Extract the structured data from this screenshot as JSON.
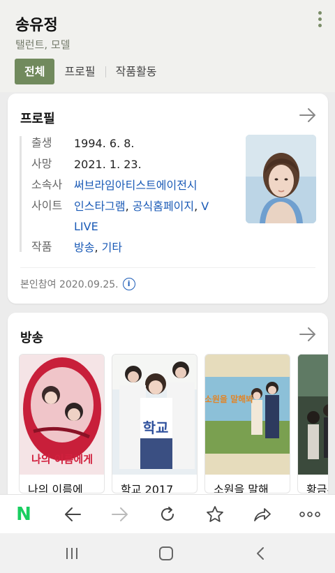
{
  "header": {
    "title": "송유정",
    "subtitle": "탤런트, 모델",
    "tabs": [
      "전체",
      "프로필",
      "작품활동"
    ]
  },
  "profile": {
    "title": "프로필",
    "rows": [
      {
        "label": "출생",
        "value": "1994. 6. 8."
      },
      {
        "label": "사망",
        "value": "2021. 1. 23."
      },
      {
        "label": "소속사",
        "value": "써브라임아티스트에이전시"
      },
      {
        "label": "사이트",
        "links": [
          "인스타그램",
          "공식홈페이지",
          "V LIVE"
        ]
      },
      {
        "label": "작품",
        "links": [
          "방송",
          "기타"
        ]
      }
    ],
    "updated": "본인참여 2020.09.25."
  },
  "broadcast": {
    "title": "방송",
    "items": [
      {
        "title": "나의 이름에",
        "poster_text": "나의 이름에게"
      },
      {
        "title": "학교 2017",
        "poster_text": "학교"
      },
      {
        "title": "소원을 말해",
        "poster_text": "소원을 말해봐"
      },
      {
        "title": "황금무",
        "poster_text": ""
      }
    ]
  },
  "browser_bar": {
    "logo": "N",
    "icons": [
      "back-arrow-icon",
      "forward-arrow-icon",
      "refresh-icon",
      "star-icon",
      "share-icon",
      "more-icon"
    ]
  },
  "system_nav": {
    "icons": [
      "recent-apps-icon",
      "home-icon",
      "back-icon"
    ]
  },
  "colors": {
    "accent": "#718a5d",
    "link": "#1a5ab6",
    "naver_green": "#19ce60"
  }
}
